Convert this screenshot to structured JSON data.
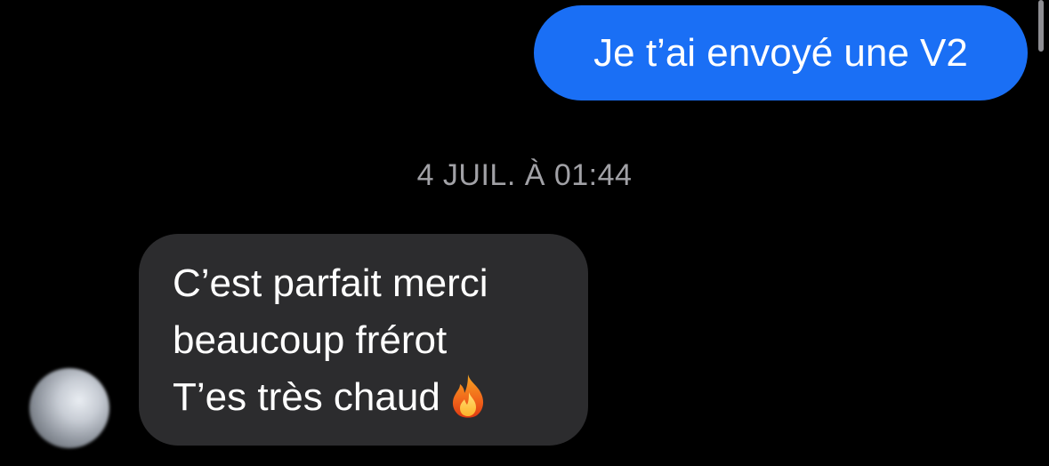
{
  "conversation": {
    "sent_message": "Je t’ai envoyé une V2",
    "timestamp": "4 JUIL. À 01:44",
    "received_message": {
      "lines": [
        "C’est parfait merci",
        "beaucoup frérot",
        "T’es très chaud"
      ],
      "emoji": "fire-icon"
    },
    "avatar": "blurred-avatar"
  },
  "colors": {
    "background": "#000000",
    "sent_bubble": "#1a6ff5",
    "received_bubble": "#2c2c2e",
    "timestamp_text": "#a1a1a6"
  }
}
